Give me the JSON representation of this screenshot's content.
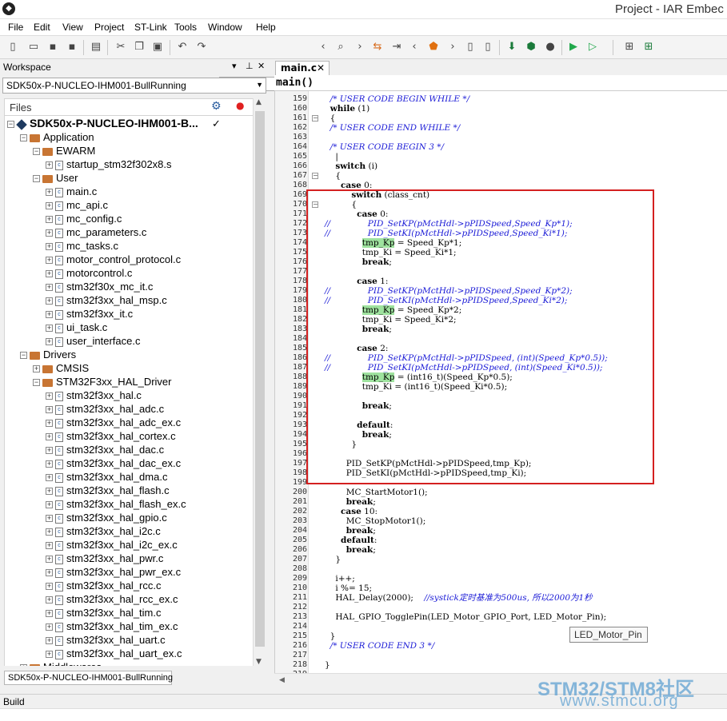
{
  "title": "Project - IAR Embec",
  "menu": [
    "File",
    "Edit",
    "View",
    "Project",
    "ST-Link",
    "Tools",
    "Window",
    "Help"
  ],
  "workspace": {
    "header": "Workspace",
    "config": "SDK50x-P-NUCLEO-IHM001-BullRunning",
    "files_label": "Files",
    "tab_label": "SDK50x-P-NUCLEO-IHM001-BullRunning",
    "tree": [
      {
        "label": "SDK50x-P-NUCLEO-IHM001-B...",
        "level": 0,
        "kind": "project",
        "exp": "−"
      },
      {
        "label": "Application",
        "level": 1,
        "kind": "folder",
        "exp": "−"
      },
      {
        "label": "EWARM",
        "level": 2,
        "kind": "folder",
        "exp": "−"
      },
      {
        "label": "startup_stm32f302x8.s",
        "level": 3,
        "kind": "file",
        "exp": "+"
      },
      {
        "label": "User",
        "level": 2,
        "kind": "folder",
        "exp": "−"
      },
      {
        "label": "main.c",
        "level": 3,
        "kind": "file",
        "exp": "+"
      },
      {
        "label": "mc_api.c",
        "level": 3,
        "kind": "file",
        "exp": "+"
      },
      {
        "label": "mc_config.c",
        "level": 3,
        "kind": "file",
        "exp": "+"
      },
      {
        "label": "mc_parameters.c",
        "level": 3,
        "kind": "file",
        "exp": "+"
      },
      {
        "label": "mc_tasks.c",
        "level": 3,
        "kind": "file",
        "exp": "+"
      },
      {
        "label": "motor_control_protocol.c",
        "level": 3,
        "kind": "file",
        "exp": "+"
      },
      {
        "label": "motorcontrol.c",
        "level": 3,
        "kind": "file",
        "exp": "+"
      },
      {
        "label": "stm32f30x_mc_it.c",
        "level": 3,
        "kind": "file",
        "exp": "+"
      },
      {
        "label": "stm32f3xx_hal_msp.c",
        "level": 3,
        "kind": "file",
        "exp": "+"
      },
      {
        "label": "stm32f3xx_it.c",
        "level": 3,
        "kind": "file",
        "exp": "+"
      },
      {
        "label": "ui_task.c",
        "level": 3,
        "kind": "file",
        "exp": "+"
      },
      {
        "label": "user_interface.c",
        "level": 3,
        "kind": "file",
        "exp": "+"
      },
      {
        "label": "Drivers",
        "level": 1,
        "kind": "folder",
        "exp": "−"
      },
      {
        "label": "CMSIS",
        "level": 2,
        "kind": "folder",
        "exp": "+"
      },
      {
        "label": "STM32F3xx_HAL_Driver",
        "level": 2,
        "kind": "folder",
        "exp": "−"
      },
      {
        "label": "stm32f3xx_hal.c",
        "level": 3,
        "kind": "file",
        "exp": "+"
      },
      {
        "label": "stm32f3xx_hal_adc.c",
        "level": 3,
        "kind": "file",
        "exp": "+"
      },
      {
        "label": "stm32f3xx_hal_adc_ex.c",
        "level": 3,
        "kind": "file",
        "exp": "+"
      },
      {
        "label": "stm32f3xx_hal_cortex.c",
        "level": 3,
        "kind": "file",
        "exp": "+"
      },
      {
        "label": "stm32f3xx_hal_dac.c",
        "level": 3,
        "kind": "file",
        "exp": "+"
      },
      {
        "label": "stm32f3xx_hal_dac_ex.c",
        "level": 3,
        "kind": "file",
        "exp": "+"
      },
      {
        "label": "stm32f3xx_hal_dma.c",
        "level": 3,
        "kind": "file",
        "exp": "+"
      },
      {
        "label": "stm32f3xx_hal_flash.c",
        "level": 3,
        "kind": "file",
        "exp": "+"
      },
      {
        "label": "stm32f3xx_hal_flash_ex.c",
        "level": 3,
        "kind": "file",
        "exp": "+"
      },
      {
        "label": "stm32f3xx_hal_gpio.c",
        "level": 3,
        "kind": "file",
        "exp": "+"
      },
      {
        "label": "stm32f3xx_hal_i2c.c",
        "level": 3,
        "kind": "file",
        "exp": "+"
      },
      {
        "label": "stm32f3xx_hal_i2c_ex.c",
        "level": 3,
        "kind": "file",
        "exp": "+"
      },
      {
        "label": "stm32f3xx_hal_pwr.c",
        "level": 3,
        "kind": "file",
        "exp": "+"
      },
      {
        "label": "stm32f3xx_hal_pwr_ex.c",
        "level": 3,
        "kind": "file",
        "exp": "+"
      },
      {
        "label": "stm32f3xx_hal_rcc.c",
        "level": 3,
        "kind": "file",
        "exp": "+"
      },
      {
        "label": "stm32f3xx_hal_rcc_ex.c",
        "level": 3,
        "kind": "file",
        "exp": "+"
      },
      {
        "label": "stm32f3xx_hal_tim.c",
        "level": 3,
        "kind": "file",
        "exp": "+"
      },
      {
        "label": "stm32f3xx_hal_tim_ex.c",
        "level": 3,
        "kind": "file",
        "exp": "+"
      },
      {
        "label": "stm32f3xx_hal_uart.c",
        "level": 3,
        "kind": "file",
        "exp": "+"
      },
      {
        "label": "stm32f3xx_hal_uart_ex.c",
        "level": 3,
        "kind": "file",
        "exp": "+"
      },
      {
        "label": "Middlewares",
        "level": 1,
        "kind": "folder",
        "exp": "+"
      }
    ]
  },
  "editor": {
    "tab": "main.c",
    "function": "main()",
    "tooltip": "LED_Motor_Pin",
    "lines": [
      {
        "n": "159",
        "t": "  /* USER CODE BEGIN WHILE */",
        "c": "cm"
      },
      {
        "n": "160",
        "t": "  while (1)",
        "c": "kw1"
      },
      {
        "n": "161",
        "t": "  {",
        "f": "−"
      },
      {
        "n": "162",
        "t": "  /* USER CODE END WHILE */",
        "c": "cm"
      },
      {
        "n": "163",
        "t": ""
      },
      {
        "n": "164",
        "t": "  /* USER CODE BEGIN 3 */",
        "c": "cm"
      },
      {
        "n": "165",
        "t": "    |"
      },
      {
        "n": "166",
        "t": "    switch (i)",
        "c": "kw1"
      },
      {
        "n": "167",
        "t": "    {",
        "f": "−"
      },
      {
        "n": "168",
        "t": "      case 0:",
        "c": "kw1"
      },
      {
        "n": "169",
        "t": "          switch (class_cnt)",
        "c": "kw1"
      },
      {
        "n": "170",
        "t": "          {",
        "f": "−"
      },
      {
        "n": "171",
        "t": "            case 0:",
        "c": "kw1"
      },
      {
        "n": "172",
        "t": "//              PID_SetKP(pMctHdl->pPIDSpeed,Speed_Kp*1);",
        "c": "cm"
      },
      {
        "n": "173",
        "t": "//              PID_SetKI(pMctHdl->pPIDSpeed,Speed_Ki*1);",
        "c": "cm"
      },
      {
        "n": "174",
        "t": "              tmp_Kp = Speed_Kp*1;",
        "c": "hl"
      },
      {
        "n": "175",
        "t": "              tmp_Ki = Speed_Ki*1;"
      },
      {
        "n": "176",
        "t": "              break;",
        "c": "kw1"
      },
      {
        "n": "177",
        "t": ""
      },
      {
        "n": "178",
        "t": "            case 1:",
        "c": "kw1"
      },
      {
        "n": "179",
        "t": "//              PID_SetKP(pMctHdl->pPIDSpeed,Speed_Kp*2);",
        "c": "cm"
      },
      {
        "n": "180",
        "t": "//              PID_SetKI(pMctHdl->pPIDSpeed,Speed_Ki*2);",
        "c": "cm"
      },
      {
        "n": "181",
        "t": "              tmp_Kp = Speed_Kp*2;",
        "c": "hl"
      },
      {
        "n": "182",
        "t": "              tmp_Ki = Speed_Ki*2;"
      },
      {
        "n": "183",
        "t": "              break;",
        "c": "kw1"
      },
      {
        "n": "184",
        "t": ""
      },
      {
        "n": "185",
        "t": "            case 2:",
        "c": "kw1"
      },
      {
        "n": "186",
        "t": "//              PID_SetKP(pMctHdl->pPIDSpeed, (int)(Speed_Kp*0.5));",
        "c": "cm"
      },
      {
        "n": "187",
        "t": "//              PID_SetKI(pMctHdl->pPIDSpeed, (int)(Speed_Ki*0.5));",
        "c": "cm"
      },
      {
        "n": "188",
        "t": "              tmp_Kp = (int16_t)(Speed_Kp*0.5);",
        "c": "hl"
      },
      {
        "n": "189",
        "t": "              tmp_Ki = (int16_t)(Speed_Ki*0.5);"
      },
      {
        "n": "190",
        "t": ""
      },
      {
        "n": "191",
        "t": "              break;",
        "c": "kw1"
      },
      {
        "n": "192",
        "t": ""
      },
      {
        "n": "193",
        "t": "            default:",
        "c": "kw1"
      },
      {
        "n": "194",
        "t": "              break;",
        "c": "kw1"
      },
      {
        "n": "195",
        "t": "          }"
      },
      {
        "n": "196",
        "t": ""
      },
      {
        "n": "197",
        "t": "        PID_SetKP(pMctHdl->pPIDSpeed,tmp_Kp);"
      },
      {
        "n": "198",
        "t": "        PID_SetKI(pMctHdl->pPIDSpeed,tmp_Ki);"
      },
      {
        "n": "199",
        "t": ""
      },
      {
        "n": "200",
        "t": "        MC_StartMotor1();"
      },
      {
        "n": "201",
        "t": "        break;",
        "c": "kw1"
      },
      {
        "n": "202",
        "t": "      case 10:",
        "c": "kw1"
      },
      {
        "n": "203",
        "t": "        MC_StopMotor1();"
      },
      {
        "n": "204",
        "t": "        break;",
        "c": "kw1"
      },
      {
        "n": "205",
        "t": "      default:",
        "c": "kw1"
      },
      {
        "n": "206",
        "t": "        break;",
        "c": "kw1"
      },
      {
        "n": "207",
        "t": "    }"
      },
      {
        "n": "208",
        "t": ""
      },
      {
        "n": "209",
        "t": "    i++;"
      },
      {
        "n": "210",
        "t": "    i %= 15;"
      },
      {
        "n": "211",
        "t": "    HAL_Delay(2000);    //systick定时基准为500us, 所以2000为1秒",
        "c": "mix"
      },
      {
        "n": "212",
        "t": ""
      },
      {
        "n": "213",
        "t": "    HAL_GPIO_TogglePin(LED_Motor_GPIO_Port, LED_Motor_Pin);"
      },
      {
        "n": "214",
        "t": ""
      },
      {
        "n": "215",
        "t": "  }"
      },
      {
        "n": "216",
        "t": "  /* USER CODE END 3 */",
        "c": "cm"
      },
      {
        "n": "217",
        "t": ""
      },
      {
        "n": "218",
        "t": "}"
      },
      {
        "n": "219",
        "t": ""
      }
    ]
  },
  "build_label": "Build",
  "watermark": {
    "line1": "STM32/STM8社区",
    "line2": "www.stmcu.org"
  },
  "colors": {
    "comment": "#1a1ad6",
    "highlight": "#9ee29e",
    "redbox": "#d42020",
    "watermark": "#6aa7d4"
  }
}
